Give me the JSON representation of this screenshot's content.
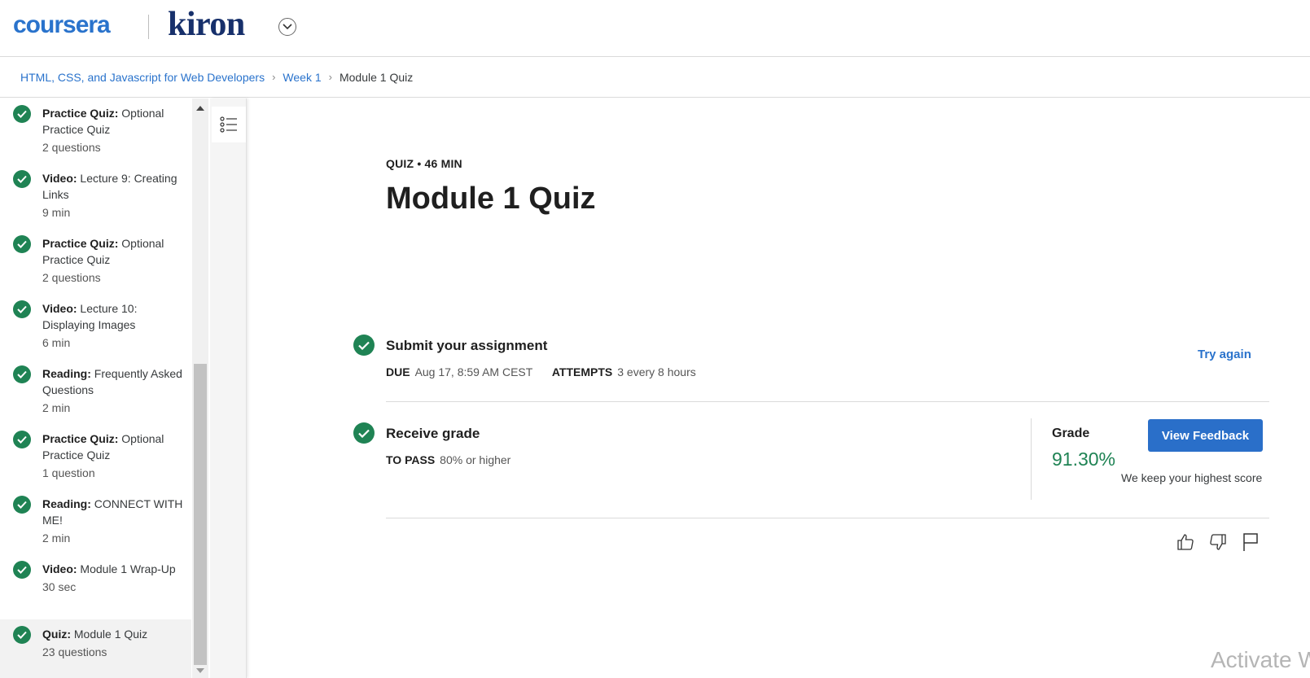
{
  "header": {
    "logo_coursera": "coursera",
    "logo_partner": "kiron"
  },
  "breadcrumb": {
    "course": "HTML, CSS, and Javascript for Web Developers",
    "week": "Week 1",
    "current": "Module 1 Quiz"
  },
  "sidebar": {
    "items": [
      {
        "type": "Practice Quiz:",
        "title": "Optional Practice Quiz",
        "meta": "2 questions",
        "completed": true
      },
      {
        "type": "Video:",
        "title": "Lecture 9: Creating Links",
        "meta": "9 min",
        "completed": true
      },
      {
        "type": "Practice Quiz:",
        "title": "Optional Practice Quiz",
        "meta": "2 questions",
        "completed": true
      },
      {
        "type": "Video:",
        "title": "Lecture 10: Displaying Images",
        "meta": "6 min",
        "completed": true
      },
      {
        "type": "Reading:",
        "title": "Frequently Asked Questions",
        "meta": "2 min",
        "completed": true
      },
      {
        "type": "Practice Quiz:",
        "title": "Optional Practice Quiz",
        "meta": "1 question",
        "completed": true
      },
      {
        "type": "Reading:",
        "title": "CONNECT WITH ME!",
        "meta": "2 min",
        "completed": true
      },
      {
        "type": "Video:",
        "title": "Module 1 Wrap-Up",
        "meta": "30 sec",
        "completed": true
      },
      {
        "type": "Quiz:",
        "title": "Module 1 Quiz",
        "meta": "23 questions",
        "completed": true
      }
    ]
  },
  "main": {
    "quiz_label": "QUIZ • 46 MIN",
    "title": "Module 1 Quiz",
    "submit": {
      "title": "Submit your assignment",
      "due_label": "DUE",
      "due_value": "Aug 17, 8:59 AM CEST",
      "attempts_label": "ATTEMPTS",
      "attempts_value": "3 every 8 hours",
      "try_again": "Try again"
    },
    "receive": {
      "title": "Receive grade",
      "pass_label": "TO PASS",
      "pass_value": "80% or higher",
      "grade_label": "Grade",
      "grade_value": "91.30%",
      "view_feedback": "View Feedback",
      "keep_note": "We keep your highest score"
    }
  },
  "watermark": "Activate W",
  "colors": {
    "brand_blue": "#2a73cc",
    "success_green": "#1f8354",
    "button_blue": "#2a6fc9"
  },
  "icons": [
    "chevron-down-icon",
    "checkmark-icon",
    "list-toggle-icon",
    "thumbs-up-icon",
    "thumbs-down-icon",
    "flag-icon"
  ]
}
